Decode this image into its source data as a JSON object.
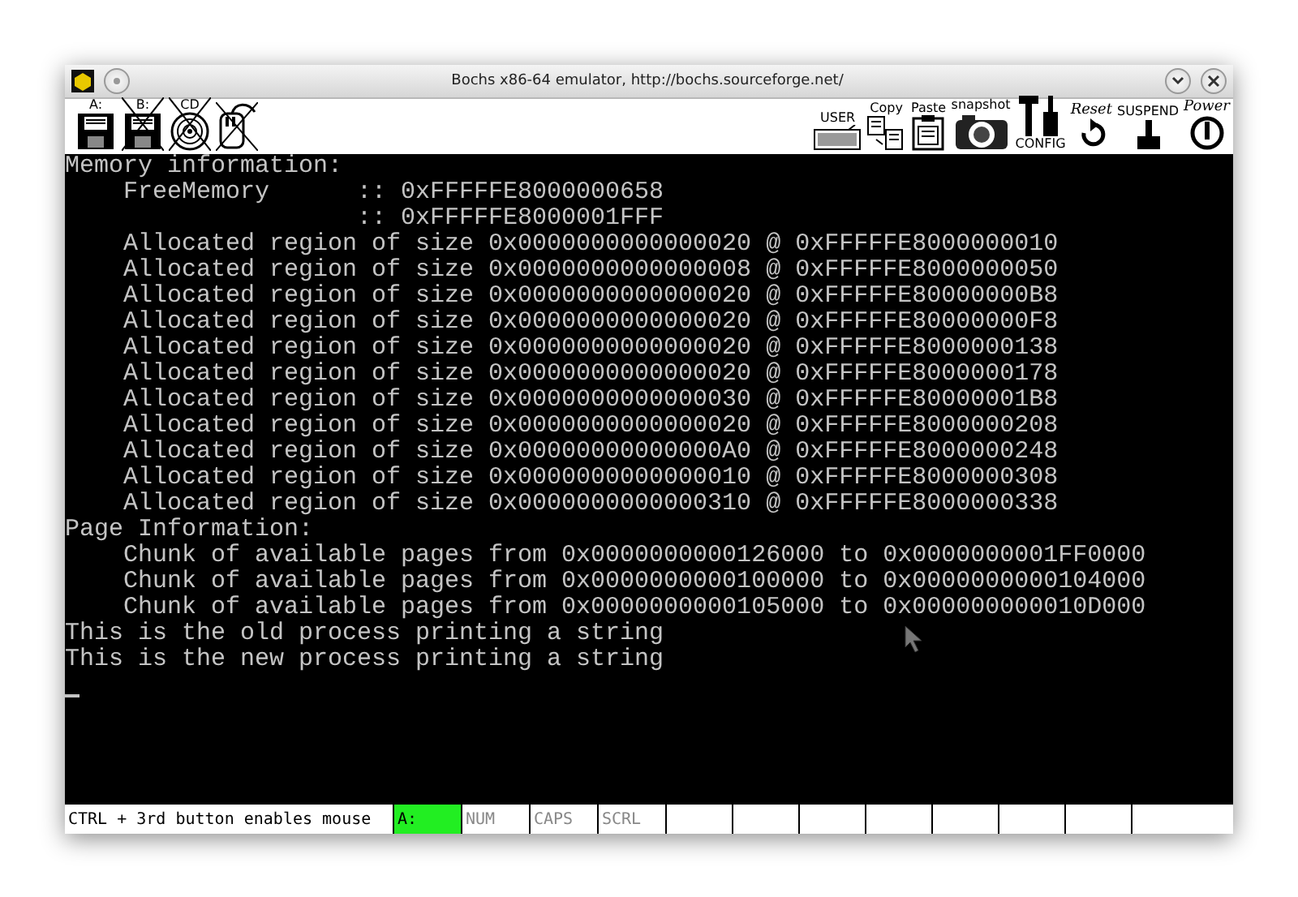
{
  "window": {
    "title": "Bochs x86-64 emulator, http://bochs.sourceforge.net/"
  },
  "toolbar": {
    "left": [
      {
        "label": "A:",
        "kind": "floppy",
        "disabled": false
      },
      {
        "label": "B:",
        "kind": "floppy",
        "disabled": true
      },
      {
        "label": "CD",
        "kind": "cdrom",
        "disabled": true
      },
      {
        "kind": "mouse",
        "disabled": true
      }
    ],
    "right": [
      {
        "label": "USER",
        "kind": "keyboard"
      },
      {
        "label": "Copy",
        "kind": "copy"
      },
      {
        "label": "Paste",
        "kind": "paste"
      },
      {
        "label": "snapshot",
        "kind": "camera"
      },
      {
        "label": "CONFIG",
        "kind": "config"
      },
      {
        "label": "Reset",
        "kind": "reset"
      },
      {
        "label": "SUSPEND",
        "kind": "suspend"
      },
      {
        "label": "Power",
        "kind": "power"
      }
    ]
  },
  "console": {
    "sections": [
      {
        "heading": "Memory information:",
        "children": [
          {
            "kind": "field",
            "label": "FreeMemory",
            "value": ":: 0xFFFFFE8000000658"
          },
          {
            "kind": "field",
            "value": ":: 0xFFFFFE8000001FFF"
          },
          {
            "kind": "line",
            "text": "Allocated region of size 0x0000000000000020 @ 0xFFFFFE8000000010"
          },
          {
            "kind": "line",
            "text": "Allocated region of size 0x0000000000000008 @ 0xFFFFFE8000000050"
          },
          {
            "kind": "line",
            "text": "Allocated region of size 0x0000000000000020 @ 0xFFFFFE80000000B8"
          },
          {
            "kind": "line",
            "text": "Allocated region of size 0x0000000000000020 @ 0xFFFFFE80000000F8"
          },
          {
            "kind": "line",
            "text": "Allocated region of size 0x0000000000000020 @ 0xFFFFFE8000000138"
          },
          {
            "kind": "line",
            "text": "Allocated region of size 0x0000000000000020 @ 0xFFFFFE8000000178"
          },
          {
            "kind": "line",
            "text": "Allocated region of size 0x0000000000000030 @ 0xFFFFFE80000001B8"
          },
          {
            "kind": "line",
            "text": "Allocated region of size 0x0000000000000020 @ 0xFFFFFE8000000208"
          },
          {
            "kind": "line",
            "text": "Allocated region of size 0x00000000000000A0 @ 0xFFFFFE8000000248"
          },
          {
            "kind": "line",
            "text": "Allocated region of size 0x0000000000000010 @ 0xFFFFFE8000000308"
          },
          {
            "kind": "line",
            "text": "Allocated region of size 0x0000000000000310 @ 0xFFFFFE8000000338"
          }
        ]
      },
      {
        "heading": "Page Information:",
        "children": [
          {
            "kind": "line",
            "text": "Chunk of available pages from 0x0000000000126000 to 0x0000000001FF0000"
          },
          {
            "kind": "line",
            "text": "Chunk of available pages from 0x0000000000100000 to 0x0000000000104000"
          },
          {
            "kind": "line",
            "text": "Chunk of available pages from 0x0000000000105000 to 0x000000000010D000"
          }
        ]
      },
      {
        "heading": "This is the old process printing a string"
      },
      {
        "heading": "This is the new process printing a string"
      }
    ]
  },
  "status_bar": {
    "message": "CTRL + 3rd button enables mouse",
    "indicators": [
      {
        "label": "A:",
        "on": true
      },
      {
        "label": "NUM",
        "on": false
      },
      {
        "label": "CAPS",
        "on": false
      },
      {
        "label": "SCRL",
        "on": false
      }
    ]
  }
}
